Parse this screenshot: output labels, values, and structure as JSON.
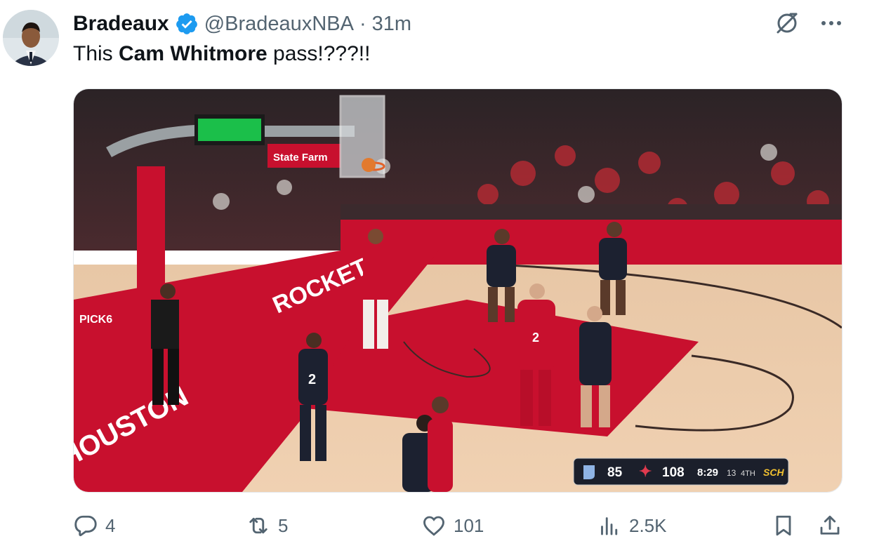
{
  "author": {
    "name": "Bradeaux",
    "handle": "@BradeauxNBA",
    "separator": "·",
    "time": "31m"
  },
  "tweet": {
    "text_before": "This ",
    "text_bold": "Cam Whitmore",
    "text_after": " pass!???!!"
  },
  "video": {
    "scoreboard": {
      "away_score": "85",
      "home_score": "108",
      "clock": "8:29",
      "shot_clock": "13",
      "quarter": "4TH",
      "network": "SCH"
    },
    "arena_signs": {
      "sponsor": "State Farm",
      "court_word": "ROCKETS",
      "baseline_word": "HOUSTON",
      "ad": "PICK6"
    },
    "jerseys": {
      "defender": "2",
      "player": "2"
    }
  },
  "actions": {
    "replies": "4",
    "reposts": "5",
    "likes": "101",
    "views": "2.5K"
  },
  "icons": [
    "verified-badge-icon",
    "grok-icon",
    "more-icon",
    "reply-icon",
    "repost-icon",
    "like-icon",
    "views-icon",
    "bookmark-icon",
    "share-icon"
  ],
  "colors": {
    "accent": "#1d9bf0",
    "muted": "#536471",
    "rockets_red": "#c8102e"
  }
}
